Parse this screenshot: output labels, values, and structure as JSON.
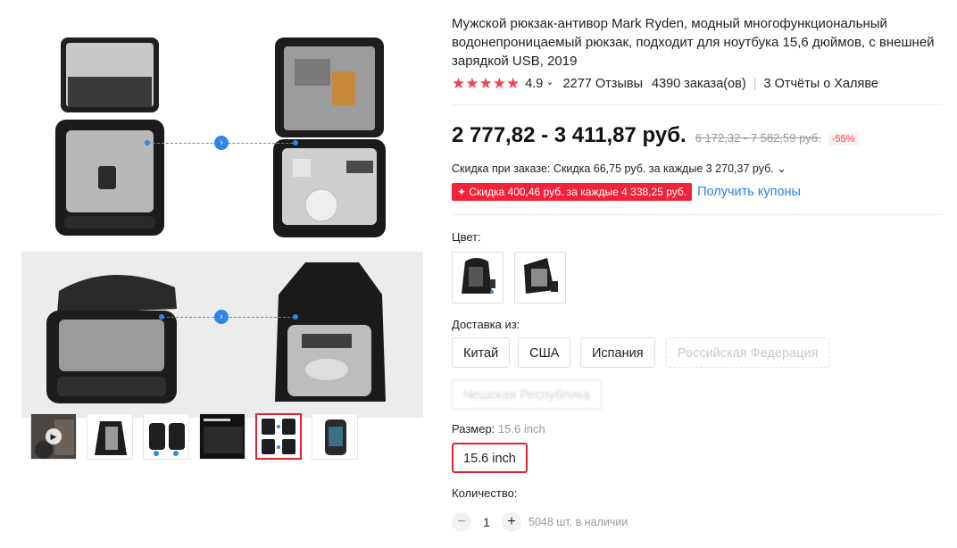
{
  "product": {
    "title": "Мужской рюкзак-антивор Mark Ryden, модный многофункциональный водонепроницаемый рюкзак, подходит для ноутбука 15,6 дюймов, с внешней зарядкой USB, 2019",
    "rating": "4.9",
    "rating_chevron": "⌄",
    "reviews": "2277 Отзывы",
    "orders": "4390 заказа(ов)",
    "reports": "3 Отчёты о Халяве",
    "stars": "★★★★★"
  },
  "price": {
    "current": "2 777,82 - 3 411,87 руб.",
    "old": "6 172,32 - 7 582,59 руб.",
    "discount": "-55%"
  },
  "promo": {
    "order_discount": "Скидка при заказе: Скидка 66,75 руб. за каждые 3 270,37 руб. ⌄",
    "coupon_badge": "✦ Скидка 400,46 руб. за каждые 4 338,25 руб.",
    "coupon_link": "Получить купоны"
  },
  "color": {
    "label": "Цвет:"
  },
  "shipping": {
    "label": "Доставка из:",
    "options": [
      "Китай",
      "США",
      "Испания",
      "Российская Федерация",
      "Чешская Республика"
    ]
  },
  "size": {
    "label": "Размер:",
    "selected_value": "15.6 inch",
    "option": "15.6 inch"
  },
  "quantity": {
    "label": "Количество:",
    "minus": "−",
    "value": "1",
    "plus": "+",
    "stock": "5048 шт. в наличии"
  },
  "gallery": {
    "play_icon": "▶",
    "arrow_icon": "›"
  },
  "colors": {
    "accent_red": "#e0232f",
    "star_red": "#f3414e",
    "link_blue": "#2783d8",
    "coupon_red": "#f0233a"
  }
}
